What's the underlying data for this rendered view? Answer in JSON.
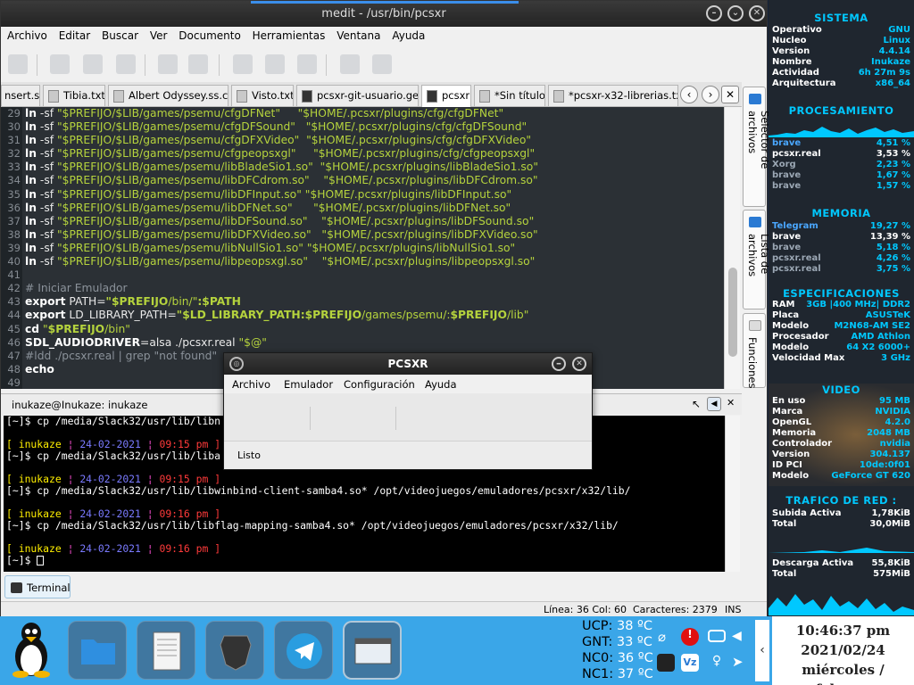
{
  "window": {
    "title": "medit - /usr/bin/pcsxr"
  },
  "menu": [
    "Archivo",
    "Editar",
    "Buscar",
    "Ver",
    "Documento",
    "Herramientas",
    "Ventana",
    "Ayuda"
  ],
  "toolbar_icons": [
    "new-icon",
    "open-icon",
    "save-icon",
    "save-as-icon",
    "undo-icon",
    "redo-icon",
    "cut-icon",
    "copy-icon",
    "paste-icon",
    "find-icon",
    "tools-icon"
  ],
  "tabs": [
    {
      "label": "nsert.sh"
    },
    {
      "label": "Tibia.txt"
    },
    {
      "label": "Albert Odyssey.ss.cfg"
    },
    {
      "label": "Visto.txt"
    },
    {
      "label": "pcsxr-git-usuario.geb"
    },
    {
      "label": "pcsxr"
    },
    {
      "label": "*Sin título"
    },
    {
      "label": "*pcsxr-x32-librerias.txt"
    }
  ],
  "side_tabs": [
    "Selector de archivos",
    "Lista de archivos",
    "Funciones"
  ],
  "code": {
    "line_numbers": [
      "29",
      "30",
      "31",
      "32",
      "33",
      "34",
      "35",
      "36",
      "37",
      "38",
      "39",
      "40",
      "41",
      "42",
      "43",
      "44",
      "45",
      "46",
      "47",
      "48",
      "49"
    ],
    "lines": [
      [
        "ln",
        " -sf ",
        "\"$PREFIJO/$LIB/games/psemu/cfgDFNet\"",
        "     ",
        "\"$HOME/.pcsxr/plugins/cfg/cfgDFNet\""
      ],
      [
        "ln",
        " -sf ",
        "\"$PREFIJO/$LIB/games/psemu/cfgDFSound\"",
        "   ",
        "\"$HOME/.pcsxr/plugins/cfg/cfgDFSound\""
      ],
      [
        "ln",
        " -sf ",
        "\"$PREFIJO/$LIB/games/psemu/cfgDFXVideo\"",
        "  ",
        "\"$HOME/.pcsxr/plugins/cfg/cfgDFXVideo\""
      ],
      [
        "ln",
        " -sf ",
        "\"$PREFIJO/$LIB/games/psemu/cfgpeopsxgl\"",
        "     ",
        "\"$HOME/.pcsxr/plugins/cfg/cfgpeopsxgl\""
      ],
      [
        "ln",
        " -sf ",
        "\"$PREFIJO/$LIB/games/psemu/libBladeSio1.so\"",
        "  ",
        "\"$HOME/.pcsxr/plugins/libBladeSio1.so\""
      ],
      [
        "ln",
        " -sf ",
        "\"$PREFIJO/$LIB/games/psemu/libDFCdrom.so\"",
        "    ",
        "\"$HOME/.pcsxr/plugins/libDFCdrom.so\""
      ],
      [
        "ln",
        " -sf ",
        "\"$PREFIJO/$LIB/games/psemu/libDFInput.so\"",
        " ",
        "\"$HOME/.pcsxr/plugins/libDFInput.so\""
      ],
      [
        "ln",
        " -sf ",
        "\"$PREFIJO/$LIB/games/psemu/libDFNet.so\"",
        "      ",
        "\"$HOME/.pcsxr/plugins/libDFNet.so\""
      ],
      [
        "ln",
        " -sf ",
        "\"$PREFIJO/$LIB/games/psemu/libDFSound.so\"",
        "    ",
        "\"$HOME/.pcsxr/plugins/libDFSound.so\""
      ],
      [
        "ln",
        " -sf ",
        "\"$PREFIJO/$LIB/games/psemu/libDFXVideo.so\"",
        "   ",
        "\"$HOME/.pcsxr/plugins/libDFXVideo.so\""
      ],
      [
        "ln",
        " -sf ",
        "\"$PREFIJO/$LIB/games/psemu/libNullSio1.so\"",
        " ",
        "\"$HOME/.pcsxr/plugins/libNullSio1.so\""
      ],
      [
        "ln",
        " -sf ",
        "\"$PREFIJO/$LIB/games/psemu/libpeopsxgl.so\"",
        "    ",
        "\"$HOME/.pcsxr/plugins/libpeopsxgl.so\""
      ]
    ],
    "blank": "",
    "comment1": "# Iniciar Emulador",
    "export_path": [
      "export",
      " PATH=",
      "\"$PREFIJO",
      "/bin/\"",
      ":$PATH"
    ],
    "export_ld": [
      "export",
      " LD_LIBRARY_PATH=",
      "\"$LD_LIBRARY_PATH:$PREFIJO",
      "/games/psemu/:",
      "$PREFIJO",
      "/lib\""
    ],
    "cd_line": [
      "cd",
      " \"",
      "$PREFIJO",
      "/bin\""
    ],
    "sdl_line": [
      "SDL_AUDIODRIVER",
      "=alsa ./pcsxr.real ",
      "\"$@\""
    ],
    "comment2": "#ldd ./pcsxr.real | grep \"not found\"",
    "echo": "echo"
  },
  "terminal": {
    "header": "inukaze@Inukaze: inukaze",
    "lines": [
      {
        "type": "cmd",
        "prompt": "[~]$",
        "text": " cp /media/Slack32/usr/lib/libn"
      },
      {
        "type": "blank"
      },
      {
        "type": "status",
        "user": "[ inukaze",
        "date": "24-02-2021",
        "time": "09:15 pm ]"
      },
      {
        "type": "cmd",
        "prompt": "[~]$",
        "text": " cp /media/Slack32/usr/lib/liba                                                    x32/lib/"
      },
      {
        "type": "blank"
      },
      {
        "type": "status",
        "user": "[ inukaze",
        "date": "24-02-2021",
        "time": "09:15 pm ]"
      },
      {
        "type": "cmd",
        "prompt": "[~]$",
        "text": " cp /media/Slack32/usr/lib/libwinbind-client-samba4.so* /opt/videojuegos/emuladores/pcsxr/x32/lib/"
      },
      {
        "type": "blank"
      },
      {
        "type": "status",
        "user": "[ inukaze",
        "date": "24-02-2021",
        "time": "09:16 pm ]"
      },
      {
        "type": "cmd",
        "prompt": "[~]$",
        "text": " cp /media/Slack32/usr/lib/libflag-mapping-samba4.so* /opt/videojuegos/emuladores/pcsxr/x32/lib/"
      },
      {
        "type": "blank"
      },
      {
        "type": "status",
        "user": "[ inukaze",
        "date": "24-02-2021",
        "time": "09:16 pm ]"
      },
      {
        "type": "cmd",
        "prompt": "[~]$",
        "text": " "
      }
    ],
    "sep": " ¦ "
  },
  "bottom_panel": {
    "terminal_button": "Terminal"
  },
  "statusbar": {
    "position": "Línea: 36 Col: 60",
    "chars": "Caracteres: 2379",
    "mode": "INS"
  },
  "pcsxr": {
    "title": "PCSXR",
    "menu": [
      "Archivo",
      "Emulador",
      "Configuración",
      "Ayuda"
    ],
    "status": "Listo"
  },
  "conky": {
    "sistema_title": "SISTEMA",
    "sistema": [
      [
        "Operativo",
        "GNU"
      ],
      [
        "Nucleo",
        "Linux"
      ],
      [
        "Version",
        "4.4.14"
      ],
      [
        "Nombre",
        "Inukaze"
      ],
      [
        "Actividad",
        "6h 27m 9s"
      ],
      [
        "Arquitectura",
        "x86_64"
      ]
    ],
    "proc_title": "PROCESAMIENTO",
    "proc": [
      [
        "brave",
        "4,51 %"
      ],
      [
        "pcsxr.real",
        "3,53 %"
      ],
      [
        "Xorg",
        "2,23 %"
      ],
      [
        "brave",
        "1,67 %"
      ],
      [
        "brave",
        "1,57 %"
      ]
    ],
    "mem_title": "MEMORIA",
    "mem": [
      [
        "Telegram",
        "19,27 %"
      ],
      [
        "brave",
        "13,39 %"
      ],
      [
        "brave",
        "5,18 %"
      ],
      [
        "pcsxr.real",
        "4,26 %"
      ],
      [
        "pcsxr.real",
        "3,75 %"
      ]
    ],
    "spec_title": "ESPECIFICACIONES",
    "spec": [
      [
        "RAM",
        "3GB |400 MHz| DDR2"
      ],
      [
        "Placa",
        "ASUSTeK"
      ],
      [
        "Modelo",
        "M2N68-AM SE2"
      ],
      [
        "Procesador",
        "AMD Athlon"
      ],
      [
        "Modelo",
        "64 X2 6000+"
      ],
      [
        "Velocidad Max",
        "3 GHz"
      ]
    ],
    "video_title": "VIDEO",
    "video": [
      [
        "En uso",
        "95 MB"
      ],
      [
        "Marca",
        "NVIDIA"
      ],
      [
        "OpenGL",
        "4.2.0"
      ],
      [
        "Memoria",
        "2048 MB"
      ],
      [
        "Controlador",
        "nvidia"
      ],
      [
        "Version",
        "304.137"
      ],
      [
        "ID PCI",
        "10de:0f01"
      ],
      [
        "Modelo",
        "GeForce GT 620"
      ]
    ],
    "net_title": "TRAFICO DE RED :",
    "up": [
      [
        "Subida Activa",
        "1,78KiB"
      ],
      [
        "Total",
        "30,0MiB"
      ]
    ],
    "down": [
      [
        "Descarga Activa",
        "55,8KiB"
      ],
      [
        "Total",
        "575MiB"
      ]
    ]
  },
  "taskbar": {
    "launchers": [
      "files-icon",
      "text-editor-icon",
      "brave-icon",
      "telegram-icon",
      "window-icon"
    ],
    "temps": [
      [
        "UCP:",
        "38 ºC"
      ],
      [
        "GNT:",
        "33 ºC"
      ],
      [
        "NC0:",
        "36 ºC"
      ],
      [
        "NC1:",
        "37 ºC"
      ]
    ],
    "clock": {
      "time": "10:46:37 pm",
      "date": "2021/02/24",
      "day": "miércoles / febrero"
    }
  },
  "colors": {
    "accent": "#3aa6e8",
    "conky_cyan": "#00c8ff",
    "string_green": "#b5d33d",
    "editor_bg": "#2b3035"
  }
}
